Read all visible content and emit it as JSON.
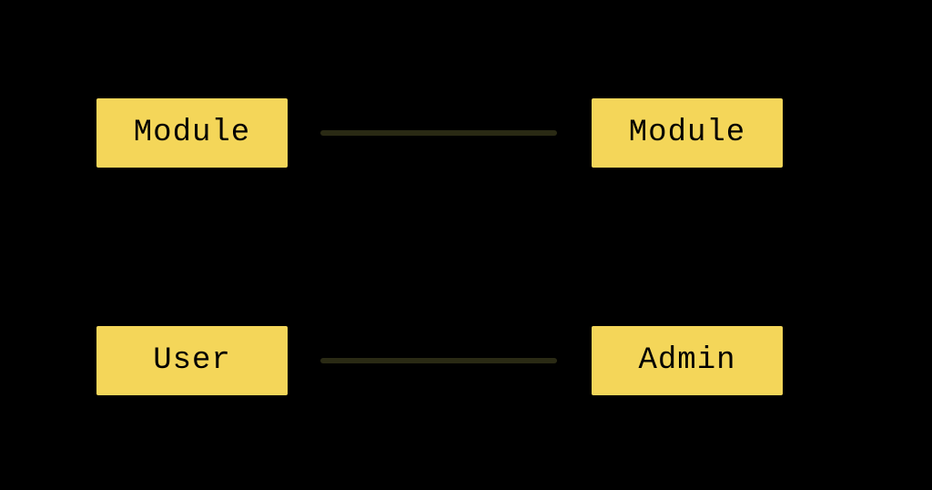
{
  "diagram": {
    "nodes": {
      "top_left": {
        "label": "Module"
      },
      "top_right": {
        "label": "Module"
      },
      "bottom_left": {
        "label": "User"
      },
      "bottom_right": {
        "label": "Admin"
      }
    },
    "connectors": [
      {
        "from": "top_left",
        "to": "top_right"
      },
      {
        "from": "bottom_left",
        "to": "bottom_right"
      }
    ],
    "colors": {
      "background": "#000000",
      "node_fill": "#f4d659",
      "node_text": "#000000",
      "connector": "#2a2a14"
    }
  }
}
